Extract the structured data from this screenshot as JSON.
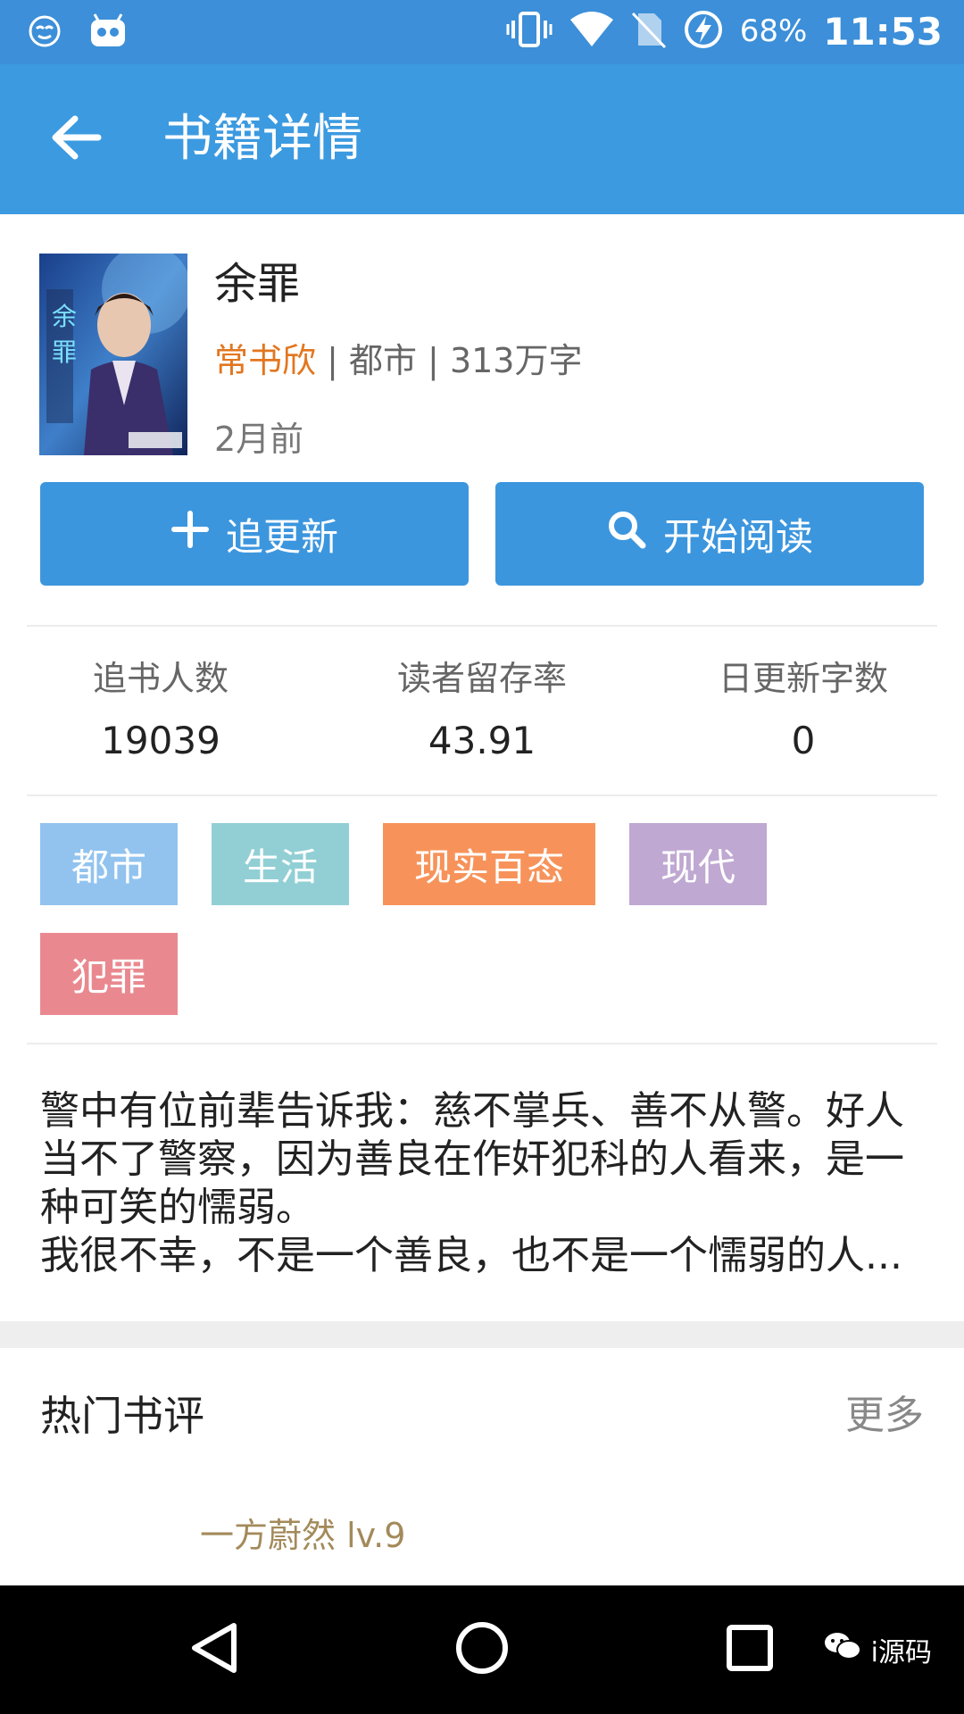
{
  "status_bar": {
    "battery_percent": "68%",
    "time": "11:53",
    "icons": [
      "emoji-face-icon",
      "android-robot-icon",
      "vibrate-icon",
      "wifi-icon",
      "no-sim-icon",
      "battery-charging-icon"
    ]
  },
  "app_bar": {
    "back_icon": "arrow-left-icon",
    "title": "书籍详情"
  },
  "book": {
    "title": "余罪",
    "author": "常书欣",
    "meta_rest": " | 都市 | 313万字",
    "updated": "2月前"
  },
  "actions": {
    "follow_label": "追更新",
    "follow_icon": "plus-icon",
    "read_label": "开始阅读",
    "read_icon": "search-icon"
  },
  "stats": [
    {
      "label": "追书人数",
      "value": "19039"
    },
    {
      "label": "读者留存率",
      "value": "43.91"
    },
    {
      "label": "日更新字数",
      "value": "0"
    }
  ],
  "tags": [
    {
      "label": "都市",
      "color": "#92c3ef"
    },
    {
      "label": "生活",
      "color": "#92cfd5"
    },
    {
      "label": "现实百态",
      "color": "#f7935a"
    },
    {
      "label": "现代",
      "color": "#bfa8d2"
    },
    {
      "label": "犯罪",
      "color": "#e9898f"
    }
  ],
  "intro": {
    "line1": "警中有位前辈告诉我：慈不掌兵、善不从警。好人当不了警察，因为善良在作奸犯科的人看来，是一种可笑的懦弱。",
    "line2": "我很不幸，不是一个善良，也不是一个懦弱的人..."
  },
  "reviews": {
    "title": "热门书评",
    "more": "更多",
    "first_reviewer": "一方蔚然 lv.9"
  },
  "nav_bar": {
    "icons": [
      "back-triangle-icon",
      "home-circle-icon",
      "recents-square-icon"
    ],
    "watermark": "i源码"
  },
  "colors": {
    "status_bar": "#3c8fd8",
    "app_bar": "#3c9ae0",
    "button": "#3c96de",
    "author": "#e2761f",
    "reviewer": "#a38a5a"
  }
}
